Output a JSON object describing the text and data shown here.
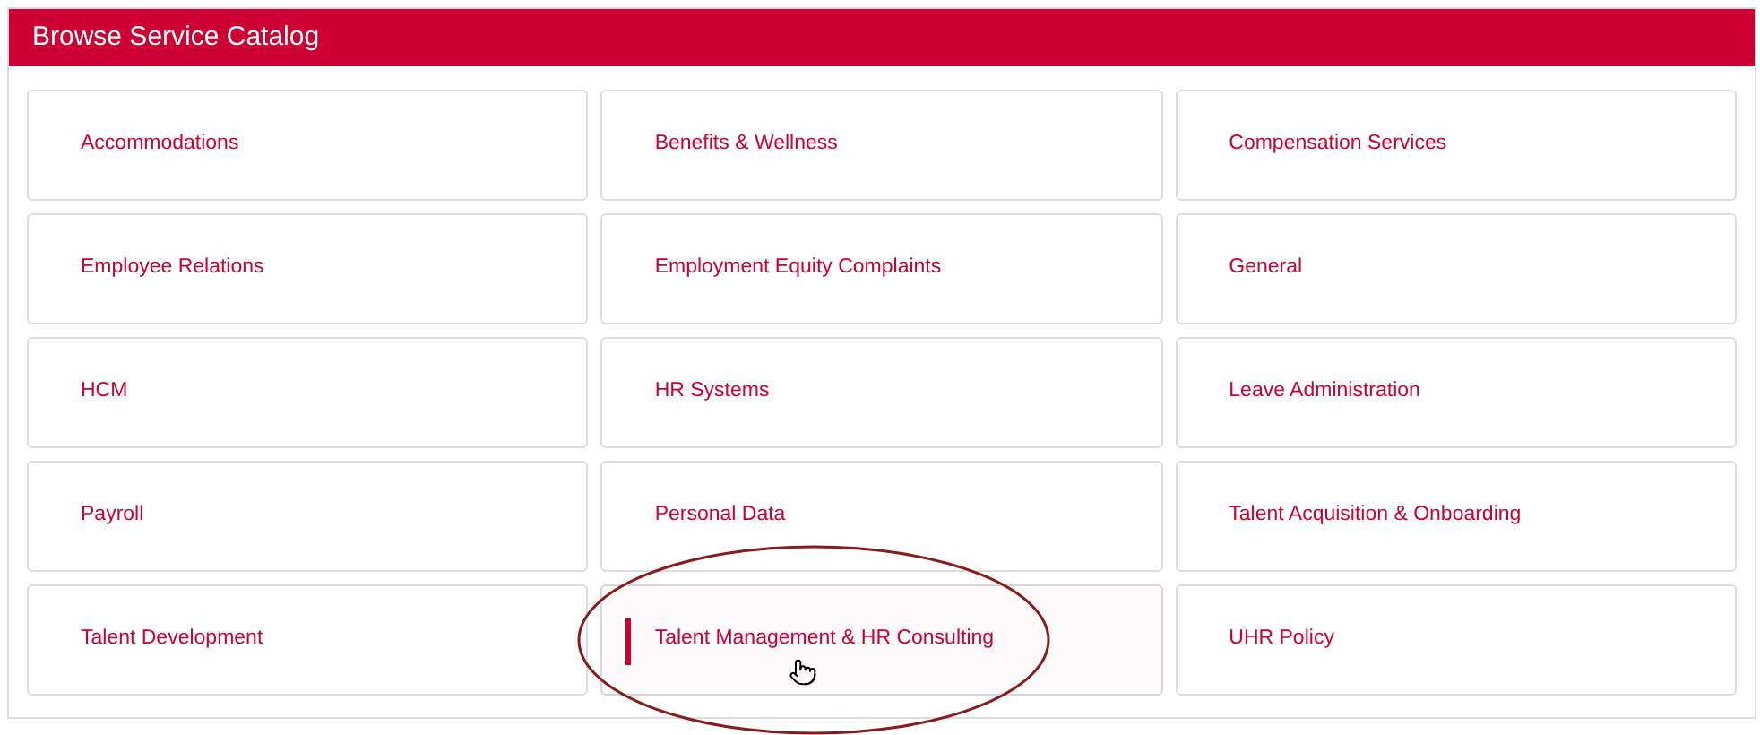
{
  "panel": {
    "title": "Browse Service Catalog"
  },
  "categories": [
    {
      "label": "Accommodations",
      "selected": false
    },
    {
      "label": "Benefits & Wellness",
      "selected": false
    },
    {
      "label": "Compensation Services",
      "selected": false
    },
    {
      "label": "Employee Relations",
      "selected": false
    },
    {
      "label": "Employment Equity Complaints",
      "selected": false
    },
    {
      "label": "General",
      "selected": false
    },
    {
      "label": "HCM",
      "selected": false
    },
    {
      "label": "HR Systems",
      "selected": false
    },
    {
      "label": "Leave Administration",
      "selected": false
    },
    {
      "label": "Payroll",
      "selected": false
    },
    {
      "label": "Personal Data",
      "selected": false
    },
    {
      "label": "Talent Acquisition & Onboarding",
      "selected": false
    },
    {
      "label": "Talent Development",
      "selected": false
    },
    {
      "label": "Talent Management & HR Consulting",
      "selected": true
    },
    {
      "label": "UHR Policy",
      "selected": false
    }
  ]
}
